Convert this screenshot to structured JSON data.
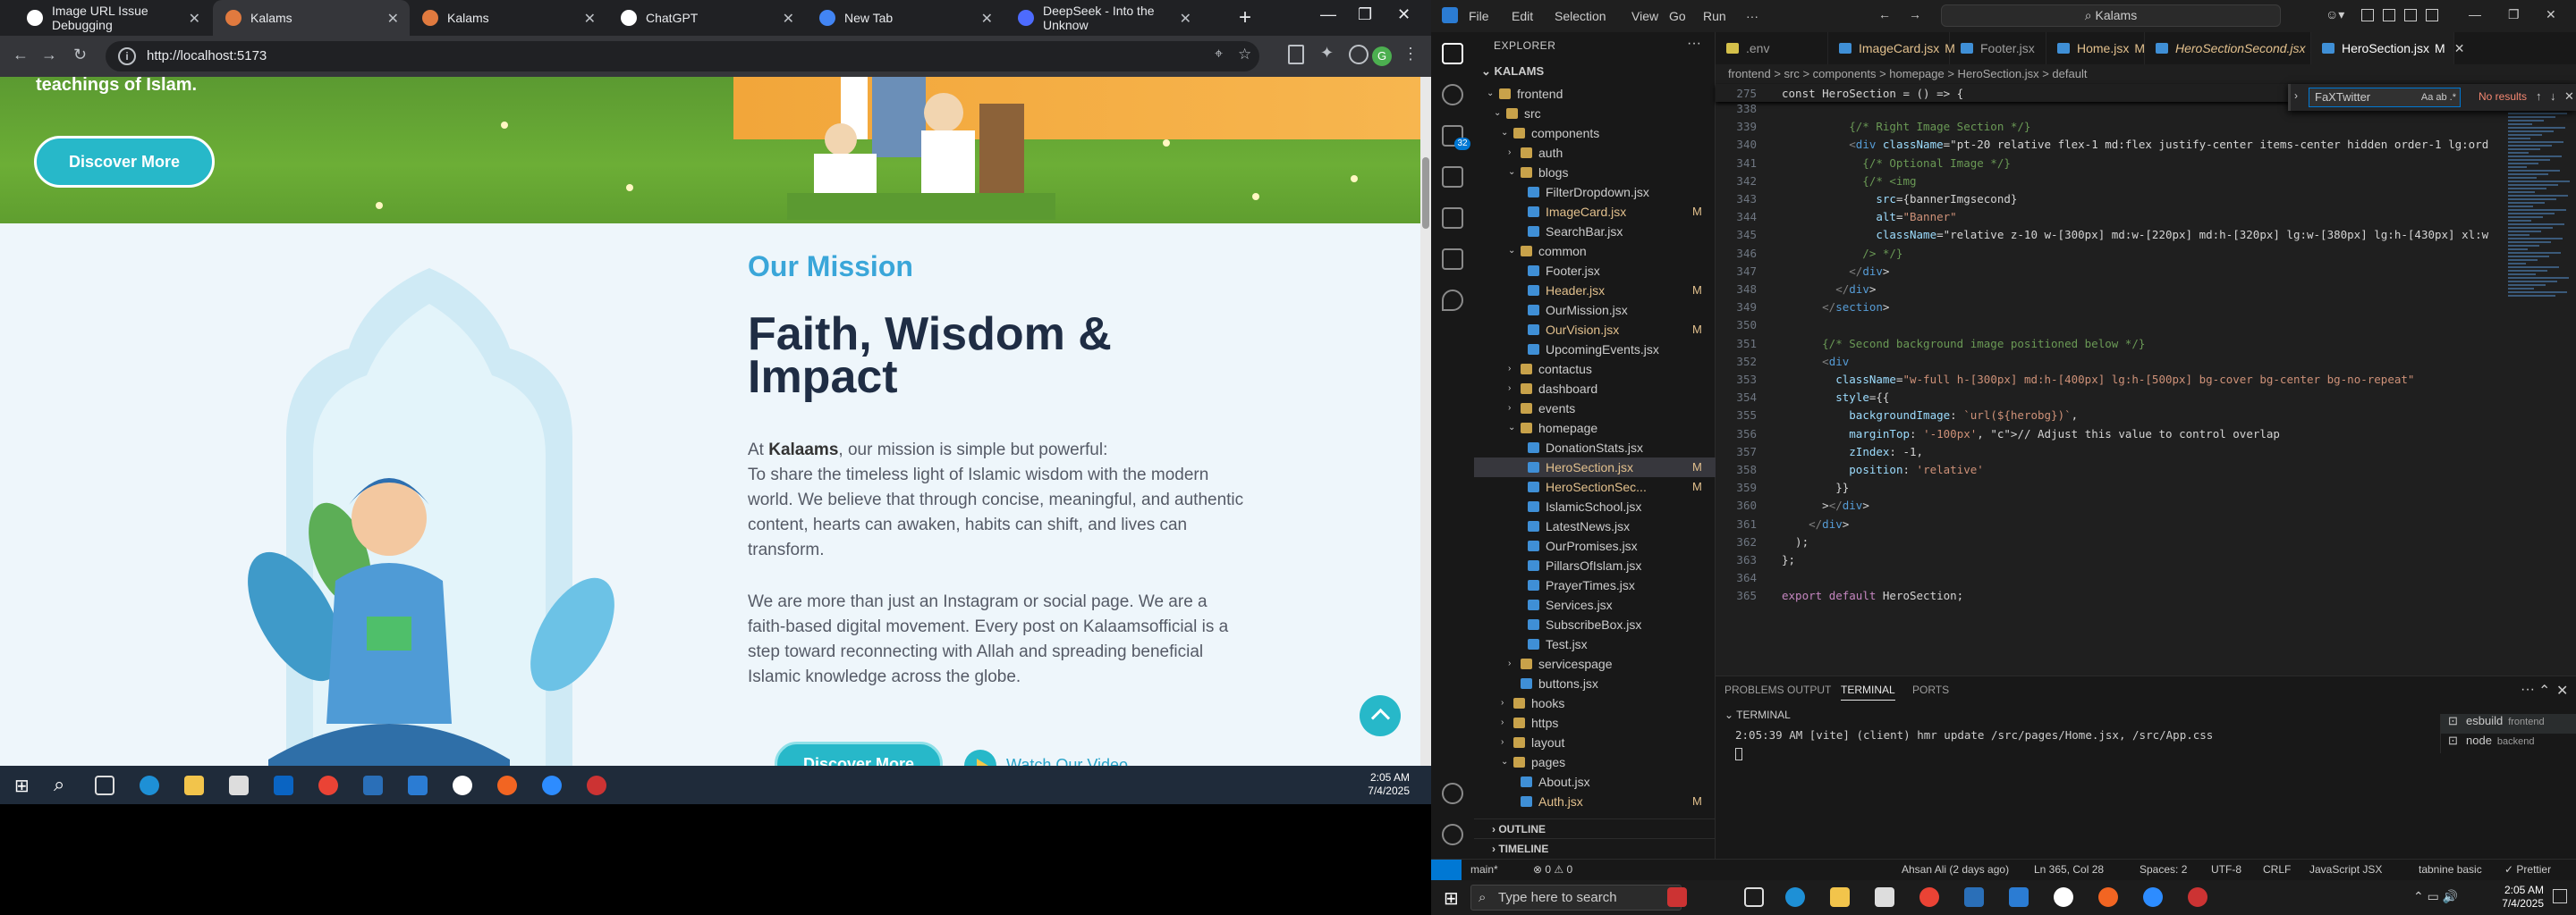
{
  "browser": {
    "tabs": [
      {
        "title": "Image URL Issue Debugging",
        "active": false,
        "color": "#ffffff"
      },
      {
        "title": "Kalams",
        "active": true,
        "color": "#e07a3f"
      },
      {
        "title": "Kalams",
        "active": false,
        "color": "#e07a3f"
      },
      {
        "title": "ChatGPT",
        "active": false,
        "color": "#ffffff"
      },
      {
        "title": "New Tab",
        "active": false,
        "color": "#4285f4"
      },
      {
        "title": "DeepSeek - Into the Unknow",
        "active": false,
        "color": "#4d6bfe"
      }
    ],
    "url": "http://localhost:5173"
  },
  "page": {
    "hero_text": "teachings of Islam.",
    "hero_button": "Discover More",
    "mission": {
      "kicker": "Our Mission",
      "title": "Faith, Wisdom & Impact",
      "p1_prefix": "At ",
      "p1_brand": "Kalaams",
      "p1_rest": ", our mission is simple but powerful:",
      "p1_body": "To share the timeless light of Islamic wisdom with the modern world. We believe that through concise, meaningful, and authentic content, hearts can awaken, habits can shift, and lives can transform.",
      "p2": "We are more than just an Instagram or social page. We are a faith-based digital movement. Every post on Kalaamsofficial is a step toward reconnecting with Allah and spreading beneficial Islamic knowledge across the globe.",
      "button": "Discover More",
      "video_link": "Watch Our Video"
    }
  },
  "left_taskbar": {
    "time": "2:05 AM",
    "date": "7/4/2025"
  },
  "vscode": {
    "menu": [
      "File",
      "Edit",
      "Selection",
      "View",
      "Go",
      "Run",
      "···"
    ],
    "search": "Kalams",
    "explorer_title": "EXPLORER",
    "root": "KALAMS",
    "activity_badge": "32",
    "tree": [
      {
        "label": "frontend",
        "type": "folder",
        "depth": 1,
        "open": true,
        "mod": false
      },
      {
        "label": "src",
        "type": "folder",
        "depth": 2,
        "open": true,
        "mod": false
      },
      {
        "label": "components",
        "type": "folder",
        "depth": 3,
        "open": true,
        "mod": false
      },
      {
        "label": "auth",
        "type": "folder",
        "depth": 4,
        "open": false,
        "mod": false
      },
      {
        "label": "blogs",
        "type": "folder",
        "depth": 4,
        "open": true,
        "mod": false
      },
      {
        "label": "FilterDropdown.jsx",
        "type": "file",
        "depth": 5,
        "mod": false
      },
      {
        "label": "ImageCard.jsx",
        "type": "file",
        "depth": 5,
        "mod": true
      },
      {
        "label": "SearchBar.jsx",
        "type": "file",
        "depth": 5,
        "mod": false
      },
      {
        "label": "common",
        "type": "folder",
        "depth": 4,
        "open": true,
        "mod": false
      },
      {
        "label": "Footer.jsx",
        "type": "file",
        "depth": 5,
        "mod": false
      },
      {
        "label": "Header.jsx",
        "type": "file",
        "depth": 5,
        "mod": true
      },
      {
        "label": "OurMission.jsx",
        "type": "file",
        "depth": 5,
        "mod": false
      },
      {
        "label": "OurVision.jsx",
        "type": "file",
        "depth": 5,
        "mod": true
      },
      {
        "label": "UpcomingEvents.jsx",
        "type": "file",
        "depth": 5,
        "mod": false
      },
      {
        "label": "contactus",
        "type": "folder",
        "depth": 4,
        "open": false,
        "mod": false
      },
      {
        "label": "dashboard",
        "type": "folder",
        "depth": 4,
        "open": false,
        "mod": false
      },
      {
        "label": "events",
        "type": "folder",
        "depth": 4,
        "open": false,
        "mod": false
      },
      {
        "label": "homepage",
        "type": "folder",
        "depth": 4,
        "open": true,
        "mod": false
      },
      {
        "label": "DonationStats.jsx",
        "type": "file",
        "depth": 5,
        "mod": false
      },
      {
        "label": "HeroSection.jsx",
        "type": "file",
        "depth": 5,
        "mod": true,
        "selected": true
      },
      {
        "label": "HeroSectionSec...",
        "type": "file",
        "depth": 5,
        "mod": true
      },
      {
        "label": "IslamicSchool.jsx",
        "type": "file",
        "depth": 5,
        "mod": false
      },
      {
        "label": "LatestNews.jsx",
        "type": "file",
        "depth": 5,
        "mod": false
      },
      {
        "label": "OurPromises.jsx",
        "type": "file",
        "depth": 5,
        "mod": false
      },
      {
        "label": "PillarsOfIslam.jsx",
        "type": "file",
        "depth": 5,
        "mod": false
      },
      {
        "label": "PrayerTimes.jsx",
        "type": "file",
        "depth": 5,
        "mod": false
      },
      {
        "label": "Services.jsx",
        "type": "file",
        "depth": 5,
        "mod": false
      },
      {
        "label": "SubscribeBox.jsx",
        "type": "file",
        "depth": 5,
        "mod": false
      },
      {
        "label": "Test.jsx",
        "type": "file",
        "depth": 5,
        "mod": false
      },
      {
        "label": "servicespage",
        "type": "folder",
        "depth": 4,
        "open": false,
        "mod": false
      },
      {
        "label": "buttons.jsx",
        "type": "file",
        "depth": 4,
        "mod": false
      },
      {
        "label": "hooks",
        "type": "folder",
        "depth": 3,
        "open": false,
        "mod": false
      },
      {
        "label": "https",
        "type": "folder",
        "depth": 3,
        "open": false,
        "mod": false
      },
      {
        "label": "layout",
        "type": "folder",
        "depth": 3,
        "open": false,
        "mod": false
      },
      {
        "label": "pages",
        "type": "folder",
        "depth": 3,
        "open": true,
        "mod": false
      },
      {
        "label": "About.jsx",
        "type": "file",
        "depth": 4,
        "mod": false
      },
      {
        "label": "Auth.jsx",
        "type": "file",
        "depth": 4,
        "mod": true
      }
    ],
    "badge_m": "M",
    "outline": "OUTLINE",
    "timeline": "TIMELINE",
    "editor_tabs": [
      {
        "label": ".env",
        "mod": false,
        "active": false,
        "italic": false
      },
      {
        "label": "ImageCard.jsx",
        "mod": true,
        "active": false,
        "italic": false
      },
      {
        "label": "Footer.jsx",
        "mod": false,
        "active": false,
        "italic": false
      },
      {
        "label": "Home.jsx",
        "mod": true,
        "active": false,
        "italic": false
      },
      {
        "label": "HeroSectionSecond.jsx",
        "mod": true,
        "active": false,
        "italic": true
      },
      {
        "label": "HeroSection.jsx",
        "mod": true,
        "active": true,
        "italic": false
      }
    ],
    "breadcrumb": "frontend > src > components > homepage > HeroSection.jsx > default",
    "sticky": {
      "line": "275",
      "code": "const HeroSection = () => {"
    },
    "find": {
      "query": "FaXTwitter",
      "result": "No results",
      "opts": "Aa  ab  .*"
    },
    "code_lines": [
      {
        "n": "338",
        "code": ""
      },
      {
        "n": "339",
        "code": "          {/* Right Image Section */}"
      },
      {
        "n": "340",
        "code": "          <div className=\"pt-20 relative flex-1 md:flex justify-center items-center hidden order-1 lg:ord"
      },
      {
        "n": "341",
        "code": "            {/* Optional Image */}"
      },
      {
        "n": "342",
        "code": "            {/* <img"
      },
      {
        "n": "343",
        "code": "              src={bannerImgsecond}"
      },
      {
        "n": "344",
        "code": "              alt=\"Banner\""
      },
      {
        "n": "345",
        "code": "              className=\"relative z-10 w-[300px] md:w-[220px] md:h-[320px] lg:w-[380px] lg:h-[430px] xl:w"
      },
      {
        "n": "346",
        "code": "            /> */}"
      },
      {
        "n": "347",
        "code": "          </div>"
      },
      {
        "n": "348",
        "code": "        </div>"
      },
      {
        "n": "349",
        "code": "      </section>"
      },
      {
        "n": "350",
        "code": ""
      },
      {
        "n": "351",
        "code": "      {/* Second background image positioned below */}"
      },
      {
        "n": "352",
        "code": "      <div"
      },
      {
        "n": "353",
        "code": "        className=\"w-full h-[300px] md:h-[400px] lg:h-[500px] bg-cover bg-center bg-no-repeat\""
      },
      {
        "n": "354",
        "code": "        style={{"
      },
      {
        "n": "355",
        "code": "          backgroundImage: `url(${herobg})`,"
      },
      {
        "n": "356",
        "code": "          marginTop: '-100px', // Adjust this value to control overlap"
      },
      {
        "n": "357",
        "code": "          zIndex: -1,"
      },
      {
        "n": "358",
        "code": "          position: 'relative'"
      },
      {
        "n": "359",
        "code": "        }}"
      },
      {
        "n": "360",
        "code": "      ></div>"
      },
      {
        "n": "361",
        "code": "    </div>"
      },
      {
        "n": "362",
        "code": "  );"
      },
      {
        "n": "363",
        "code": "};"
      },
      {
        "n": "364",
        "code": ""
      },
      {
        "n": "365",
        "code": "export default HeroSection;"
      }
    ],
    "panel_tabs": [
      "PROBLEMS",
      "OUTPUT",
      "TERMINAL",
      "PORTS"
    ],
    "panel_active": "TERMINAL",
    "terminal_title": "TERMINAL",
    "terminal_line": "2:05:39 AM [vite] (client) hmr update /src/pages/Home.jsx, /src/App.css",
    "terminals": [
      {
        "label": "esbuild",
        "sub": "frontend"
      },
      {
        "label": "node",
        "sub": "backend"
      }
    ],
    "status": {
      "branch": "main*",
      "problems": "⊗ 0 ⚠ 0",
      "author": "Ahsan Ali (2 days ago)",
      "cursor": "Ln 365, Col 28",
      "spaces": "Spaces: 2",
      "encoding": "UTF-8",
      "eol": "CRLF",
      "language": "JavaScript JSX",
      "tabnine": "tabnine basic",
      "prettier": "✓ Prettier"
    }
  },
  "right_taskbar": {
    "search_placeholder": "Type here to search",
    "time": "2:05 AM",
    "date": "7/4/2025"
  }
}
